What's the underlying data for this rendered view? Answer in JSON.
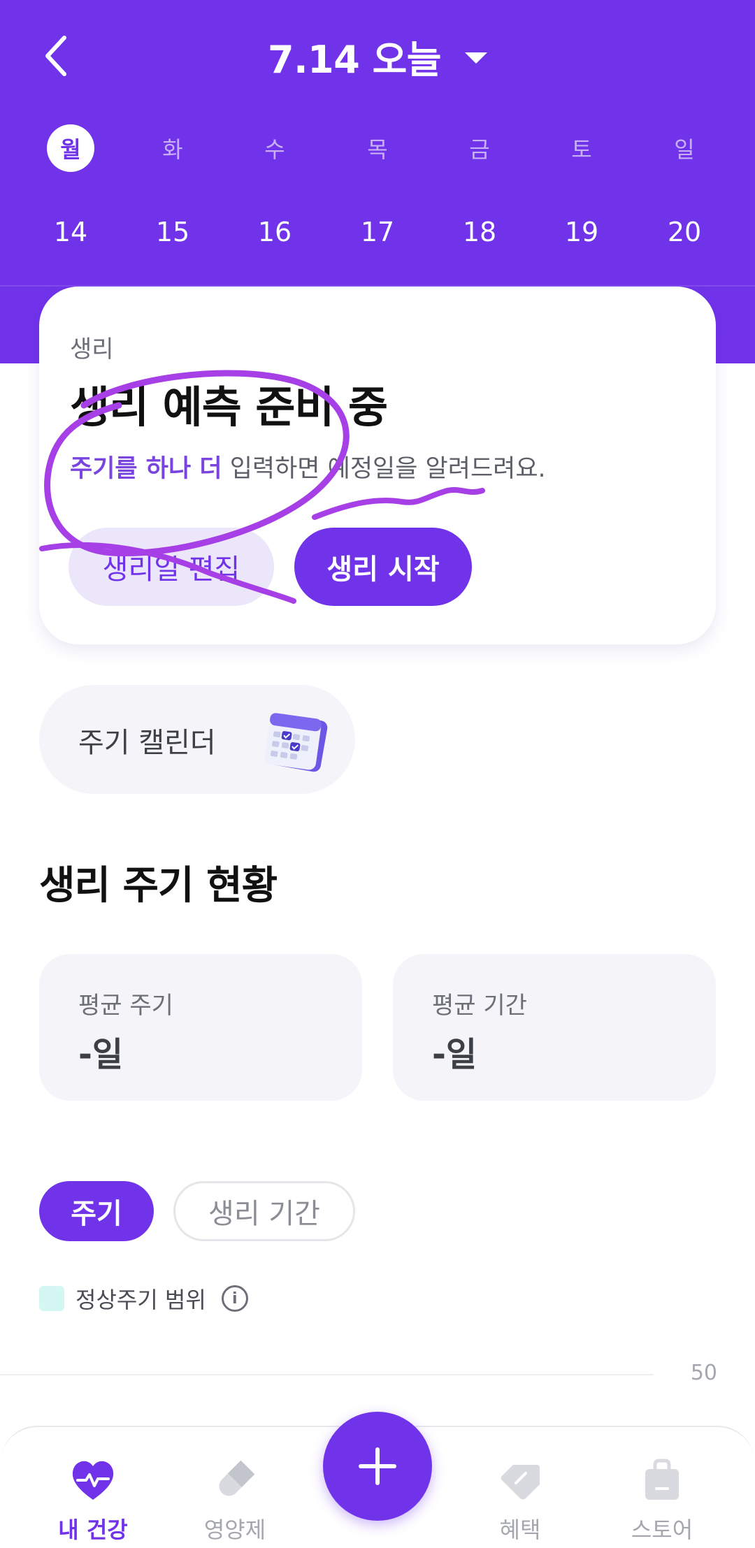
{
  "header": {
    "title": "7.14 오늘",
    "weekdays": [
      "월",
      "화",
      "수",
      "목",
      "금",
      "토",
      "일"
    ],
    "dates": [
      "14",
      "15",
      "16",
      "17",
      "18",
      "19",
      "20"
    ],
    "selected_index": 0
  },
  "period_card": {
    "label": "생리",
    "title": "생리 예측 준비 중",
    "desc_highlight": "주기를 하나 더",
    "desc_rest": " 입력하면 예정일을 알려드려요.",
    "edit_button": "생리일 편집",
    "start_button": "생리 시작"
  },
  "calendar_chip": {
    "label": "주기 캘린더"
  },
  "status_section": {
    "title": "생리 주기 현황",
    "avg_cycle_label": "평균 주기",
    "avg_cycle_value": "-일",
    "avg_period_label": "평균 기간",
    "avg_period_value": "-일"
  },
  "toggles": {
    "cycle": "주기",
    "period": "생리 기간",
    "active": "cycle"
  },
  "legend": {
    "label": "정상주기 범위",
    "info": "i"
  },
  "chart": {
    "tick": "50"
  },
  "bottom_nav": {
    "items": [
      {
        "label": "내 건강",
        "icon": "heart-pulse-icon",
        "active": true
      },
      {
        "label": "영양제",
        "icon": "pill-icon",
        "active": false
      },
      {
        "label": "혜택",
        "icon": "tag-icon",
        "active": false
      },
      {
        "label": "스토어",
        "icon": "shopping-bag-icon",
        "active": false
      }
    ],
    "fab_icon": "plus-icon"
  },
  "colors": {
    "primary": "#7133ea",
    "annotation": "#a63fe6",
    "legend_swatch": "#d4f7f3"
  }
}
